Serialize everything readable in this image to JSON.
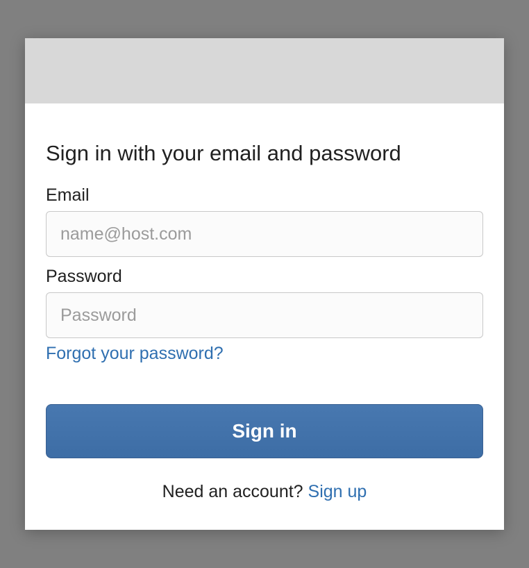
{
  "title": "Sign in with your email and password",
  "email": {
    "label": "Email",
    "placeholder": "name@host.com",
    "value": ""
  },
  "password": {
    "label": "Password",
    "placeholder": "Password",
    "value": ""
  },
  "forgot_password_label": "Forgot your password?",
  "signin_button_label": "Sign in",
  "signup_prompt": "Need an account? ",
  "signup_link_label": "Sign up",
  "colors": {
    "accent": "#3f6fa8",
    "link": "#2f6fb0",
    "header_bg": "#d8d8d8"
  }
}
